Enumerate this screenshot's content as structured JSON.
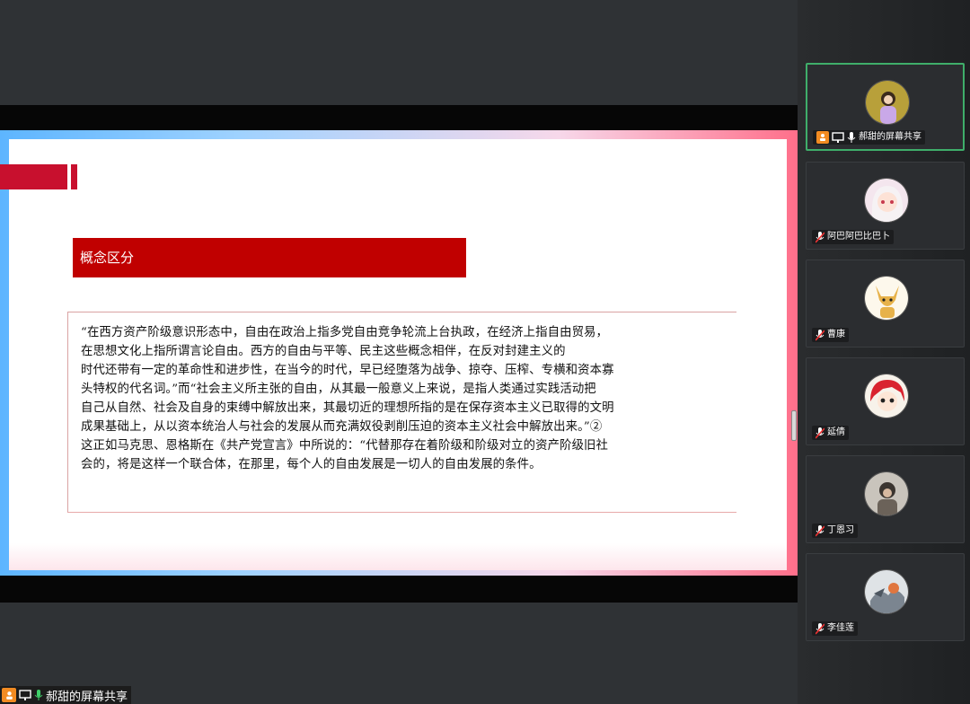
{
  "slide": {
    "heading": "概念区分",
    "quote": "“在西方资产阶级意识形态中，自由在政治上指多党自由竞争轮流上台执政，在经济上指自由贸易，\n在思想文化上指所谓言论自由。西方的自由与平等、民主这些概念相伴，在反对封建主义的\n时代还带有一定的革命性和进步性，在当今的时代，早已经堕落为战争、掠夺、压榨、专横和资本寡\n头特权的代名词。”而“社会主义所主张的自由，从其最一般意义上来说，是指人类通过实践活动把\n自己从自然、社会及自身的束缚中解放出来，其最切近的理想所指的是在保存资本主义已取得的文明\n成果基础上，从以资本统治人与社会的发展从而充满奴役剥削压迫的资本主义社会中解放出来。”②\n这正如马克思、恩格斯在《共产党宣言》中所说的：“代替那存在着阶级和阶级对立的资产阶级旧社\n会的，将是这样一个联合体，在那里，每个人的自由发展是一切人的自由发展的条件。"
  },
  "participants": [
    {
      "name": "郝甜的屏幕共享",
      "icons": [
        "screen-share-icon",
        "presenter-icon",
        "mic-icon"
      ],
      "active": true
    },
    {
      "name": "阿巴阿巴比巴卜",
      "icons": [
        "mic-muted-icon"
      ],
      "active": false
    },
    {
      "name": "曹康",
      "icons": [
        "mic-muted-icon"
      ],
      "active": false
    },
    {
      "name": "延倩",
      "icons": [
        "mic-muted-icon"
      ],
      "active": false
    },
    {
      "name": "丁恩习",
      "icons": [
        "mic-muted-icon"
      ],
      "active": false
    },
    {
      "name": "李佳莲",
      "icons": [
        "mic-muted-icon"
      ],
      "active": false
    }
  ],
  "bottom_bar": {
    "label": "郝甜的屏幕共享"
  },
  "colors": {
    "accent_red": "#c00000",
    "active_border": "#3fae6a",
    "share_orange": "#f28b22"
  }
}
